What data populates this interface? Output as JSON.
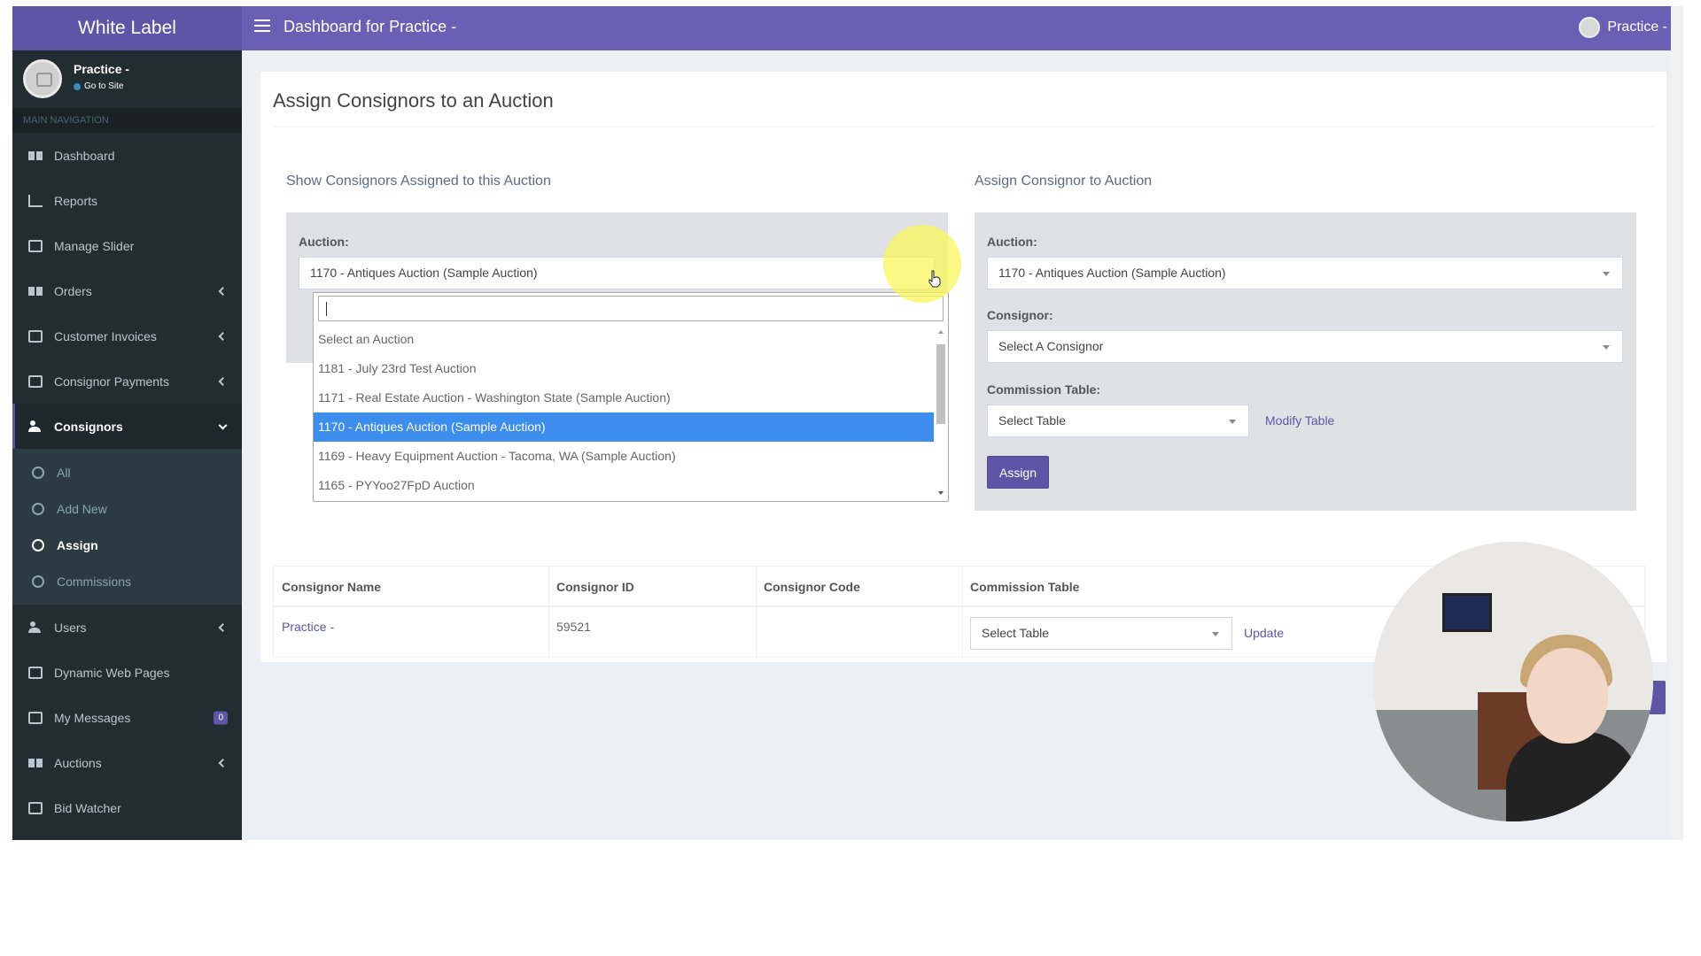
{
  "brand": "White Label",
  "topbar": {
    "title": "Dashboard for Practice -",
    "user": "Practice -"
  },
  "sidebar": {
    "user_name": "Practice -",
    "user_link": "Go to Site",
    "nav_header": "MAIN NAVIGATION",
    "items": [
      {
        "label": "Dashboard",
        "icon": "dashboard-icon"
      },
      {
        "label": "Reports",
        "icon": "bar-chart-icon"
      },
      {
        "label": "Manage Slider",
        "icon": "image-icon"
      },
      {
        "label": "Orders",
        "icon": "grid-icon"
      },
      {
        "label": "Customer Invoices",
        "icon": "invoice-icon"
      },
      {
        "label": "Consignor Payments",
        "icon": "file-icon"
      },
      {
        "label": "Consignors",
        "icon": "users-icon"
      }
    ],
    "consignors_sub": [
      "All",
      "Add New",
      "Assign",
      "Commissions"
    ],
    "items_after": [
      {
        "label": "Users",
        "icon": "users-icon"
      },
      {
        "label": "Dynamic Web Pages",
        "icon": "wrench-icon"
      },
      {
        "label": "My Messages",
        "icon": "envelope-icon",
        "badge": "0"
      },
      {
        "label": "Auctions",
        "icon": "calendar-icon"
      },
      {
        "label": "Bid Watcher",
        "icon": "monitor-icon"
      }
    ]
  },
  "main": {
    "title": "Assign Consignors to an Auction",
    "left": {
      "section_title": "Show Consignors Assigned to this Auction",
      "auction_label": "Auction:",
      "auction_value": "1170 - Antiques Auction (Sample Auction)"
    },
    "dropdown": {
      "options": [
        "Select an Auction",
        "1181 - July 23rd Test Auction",
        "1171 - Real Estate Auction - Washington State (Sample Auction)",
        "1170 - Antiques Auction (Sample Auction)",
        "1169 - Heavy Equipment Auction - Tacoma, WA (Sample Auction)",
        "1165 - PYYoo27FpD Auction"
      ],
      "selected_index": 3
    },
    "right": {
      "section_title": "Assign Consignor to Auction",
      "auction_label": "Auction:",
      "auction_value": "1170 - Antiques Auction (Sample Auction)",
      "consignor_label": "Consignor:",
      "consignor_value": "Select A Consignor",
      "commission_label": "Commission Table:",
      "commission_value": "Select Table",
      "modify_link": "Modify Table",
      "assign_button": "Assign"
    },
    "table": {
      "headers": [
        "Consignor Name",
        "Consignor ID",
        "Consignor Code",
        "Commission Table"
      ],
      "row": {
        "name": "Practice -",
        "id": "59521",
        "code": "",
        "table_select": "Select Table",
        "update": "Update"
      }
    }
  },
  "colors": {
    "brand": "#5e55a6",
    "topbar": "#6a5fb5",
    "sidebar": "#222d32",
    "selected_option": "#3c8dec"
  }
}
